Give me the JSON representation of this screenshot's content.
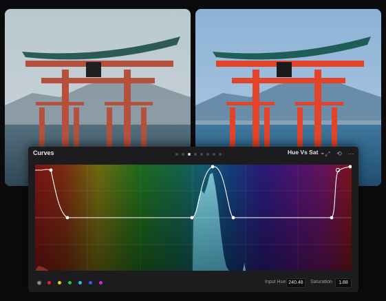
{
  "viewer": {
    "before_image": "torii gate in water, original colors",
    "after_image": "torii gate in water, hue vs saturation boosted"
  },
  "curves_panel": {
    "title": "Curves",
    "mode": "Hue Vs Sat",
    "page_dots": 8,
    "active_dot": 2,
    "swatch_colors": [
      "#e0262a",
      "#e8d21d",
      "#2fc23a",
      "#23c7e6",
      "#2f5cf0",
      "#d22ad0"
    ],
    "swatch_names": [
      "red",
      "yellow",
      "green",
      "cyan",
      "blue",
      "magenta"
    ],
    "input_hue_label": "Input Hue",
    "input_hue_value": "240.48",
    "saturation_label": "Saturation",
    "saturation_value": "1.88"
  }
}
